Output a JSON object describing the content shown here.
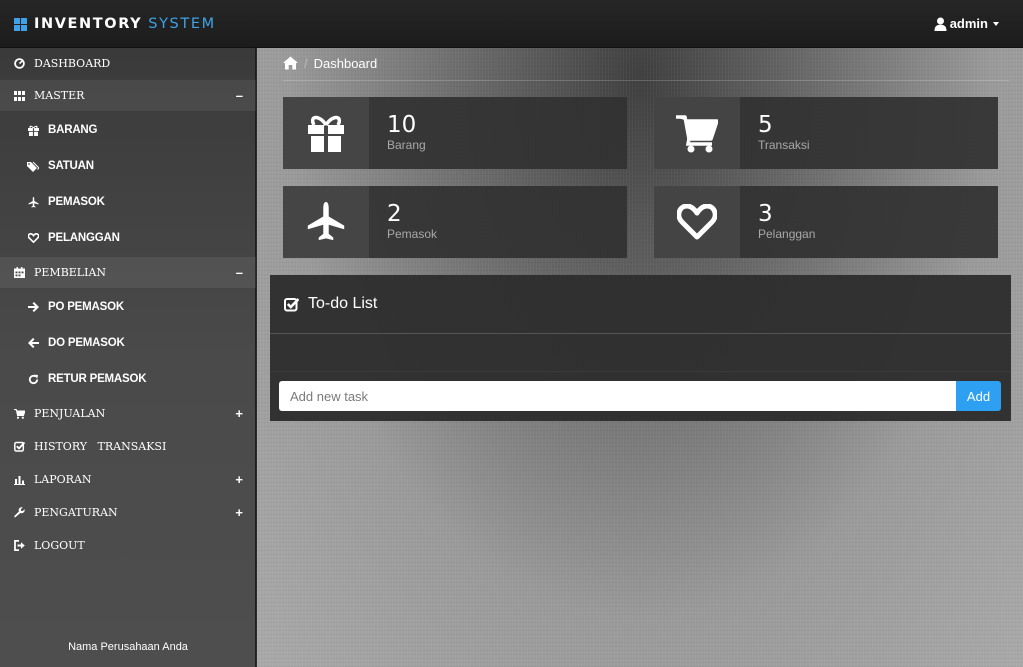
{
  "app": {
    "brand_main": "INVENTORY",
    "brand_accent": "SYSTEM",
    "accent_color": "#3ea3e6",
    "user": "admin"
  },
  "sidebar": {
    "items": [
      {
        "label": "DASHBOARD",
        "icon": "dashboard-icon"
      },
      {
        "label": "MASTER",
        "icon": "grid-icon",
        "toggle": "–"
      },
      {
        "label": "BARANG",
        "icon": "gift-icon"
      },
      {
        "label": "SATUAN",
        "icon": "tags-icon"
      },
      {
        "label": "PEMASOK",
        "icon": "plane-icon"
      },
      {
        "label": "PELANGGAN",
        "icon": "heart-icon"
      },
      {
        "label": "PEMBELIAN",
        "icon": "calendar-icon",
        "toggle": "–"
      },
      {
        "label": "PO PEMASOK",
        "icon": "arrow-right-icon"
      },
      {
        "label": "DO PEMASOK",
        "icon": "arrow-left-icon"
      },
      {
        "label": "RETUR PEMASOK",
        "icon": "refresh-icon"
      },
      {
        "label": "PENJUALAN",
        "icon": "cart-icon",
        "toggle": "+"
      },
      {
        "label": "HISTORY   TRANSAKSI",
        "icon": "check-icon"
      },
      {
        "label": "LAPORAN",
        "icon": "bar-chart-icon",
        "toggle": "+"
      },
      {
        "label": "PENGATURAN",
        "icon": "wrench-icon",
        "toggle": "+"
      },
      {
        "label": "LOGOUT",
        "icon": "logout-icon"
      }
    ],
    "footer": "Nama Perusahaan Anda"
  },
  "breadcrumb": {
    "home_icon": "home-icon",
    "separator": "/",
    "current": "Dashboard"
  },
  "stats": [
    {
      "value": "10",
      "label": "Barang",
      "icon": "gift-icon"
    },
    {
      "value": "5",
      "label": "Transaksi",
      "icon": "cart-icon"
    },
    {
      "value": "2",
      "label": "Pemasok",
      "icon": "plane-icon"
    },
    {
      "value": "3",
      "label": "Pelanggan",
      "icon": "heart-icon"
    }
  ],
  "todo": {
    "title": "To-do List",
    "input_placeholder": "Add new task",
    "add_label": "Add",
    "add_color": "#2ea0f2"
  }
}
